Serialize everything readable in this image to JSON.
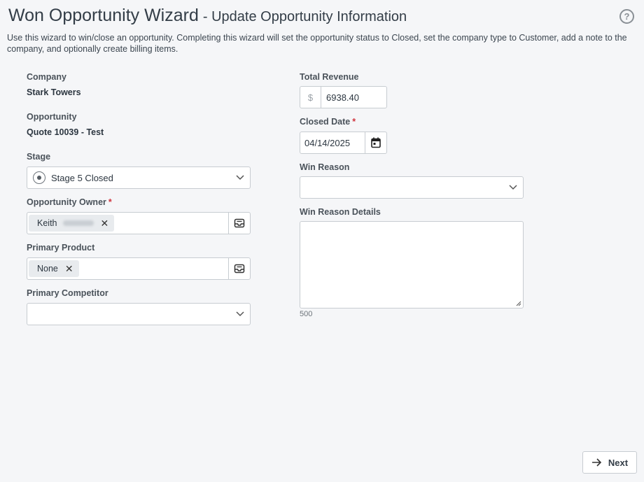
{
  "header": {
    "title": "Won Opportunity Wizard",
    "subtitle": "- Update Opportunity Information",
    "help_icon": "question-circle-icon"
  },
  "description": "Use this wizard to win/close an opportunity. Completing this wizard will set the opportunity status to Closed, set the company type to Customer, add a note to the company, and optionally create billing items.",
  "left": {
    "company_label": "Company",
    "company_value": "Stark Towers",
    "opportunity_label": "Opportunity",
    "opportunity_value": "Quote 10039 - Test",
    "stage_label": "Stage",
    "stage_value": "Stage 5 Closed",
    "owner_label": "Opportunity Owner",
    "owner_required": "*",
    "owner_value": "Keith",
    "product_label": "Primary Product",
    "product_value": "None",
    "competitor_label": "Primary Competitor",
    "competitor_value": ""
  },
  "right": {
    "revenue_label": "Total Revenue",
    "currency_symbol": "$",
    "revenue_value": "6938.40",
    "closed_date_label": "Closed Date",
    "closed_date_required": "*",
    "closed_date_value": "04/14/2025",
    "win_reason_label": "Win Reason",
    "win_reason_value": "",
    "win_details_label": "Win Reason Details",
    "win_details_value": "",
    "char_counter": "500"
  },
  "footer": {
    "next_label": "Next"
  },
  "colors": {
    "background": "#f5f6f8",
    "required": "#d0353f",
    "border": "#c7ccd1"
  }
}
